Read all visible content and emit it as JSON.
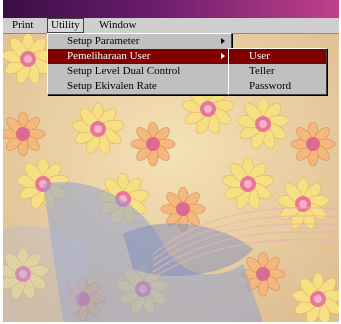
{
  "menubar": {
    "items": [
      {
        "label": "Print"
      },
      {
        "label": "Utility"
      },
      {
        "label": "Window"
      }
    ]
  },
  "utility_menu": {
    "items": [
      {
        "label": "Setup Parameter",
        "has_submenu": true
      },
      {
        "label": "Pemeliharaan User",
        "has_submenu": true,
        "highlighted": true
      },
      {
        "label": "Setup Level Dual Control",
        "has_submenu": false
      },
      {
        "label": "Setup Ekivalen Rate",
        "has_submenu": false
      }
    ]
  },
  "user_submenu": {
    "items": [
      {
        "label": "User",
        "highlighted": true
      },
      {
        "label": "Teller"
      },
      {
        "label": "Password"
      }
    ]
  },
  "colors": {
    "menu_background": "#c0c0c0",
    "highlight": "#800000",
    "highlight_text": "#ffffff",
    "titlebar_dark": "#3a0d45",
    "titlebar_light": "#c0408a"
  }
}
